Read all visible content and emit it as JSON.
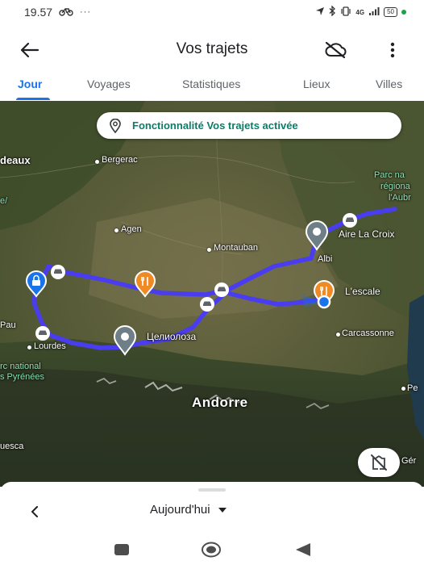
{
  "status_bar": {
    "time": "19.57",
    "left_icons": [
      "bicycle-icon",
      "more-dots"
    ],
    "right_icons": [
      "location-arrow-icon",
      "bluetooth-icon",
      "vibrate-icon",
      "signal-icon",
      "battery-icon"
    ],
    "network": "4G",
    "battery": "50"
  },
  "app_bar": {
    "title": "Vos trajets",
    "back_icon": "arrow-left-icon",
    "cloud_icon": "cloud-off-icon",
    "more_icon": "more-vert-icon"
  },
  "tabs": [
    {
      "label": "Jour",
      "active": true
    },
    {
      "label": "Voyages",
      "active": false
    },
    {
      "label": "Statistiques",
      "active": false
    },
    {
      "label": "Lieux",
      "active": false
    },
    {
      "label": "Villes",
      "active": false
    }
  ],
  "map": {
    "banner": "Fonctionnalité Vos trajets activée",
    "labels": {
      "bordeaux": "deaux",
      "bergerac": "Bergerac",
      "agen": "Agen",
      "montauban": "Montauban",
      "albi": "Albi",
      "aire": "Aire La Croix",
      "escale": "L'escale",
      "tselioloza": "Целиолоза",
      "pau": "Pau",
      "lourdes": "Lourdes",
      "carcassonne": "Carcassonne",
      "andorre": "Andorre",
      "huesca": "uesca",
      "parc_a1": "Parc na",
      "parc_a2": "régiona",
      "parc_a3": "l'Aubr",
      "parc_b1": "rc national",
      "parc_b2": "s Pyrénées",
      "left_edge": "e/",
      "perpignan": "Pe",
      "gerona": "Gér"
    },
    "route_color": "#4a3df0",
    "pin_gray": "#6f7f87",
    "pin_orange": "#f08a24",
    "pin_blue": "#1a73e8"
  },
  "sheet": {
    "date_label": "Aujourd'hui",
    "prev_icon": "chevron-left-icon",
    "dropdown_icon": "caret-down-icon"
  },
  "nav_bar": {
    "icons": [
      "recent-apps-icon",
      "home-icon",
      "back-triangle-icon"
    ]
  }
}
